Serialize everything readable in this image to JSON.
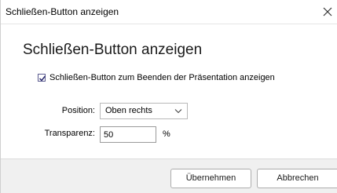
{
  "window": {
    "title": "Schließen-Button anzeigen",
    "close_icon": "close-icon"
  },
  "dialog": {
    "heading": "Schließen-Button anzeigen",
    "checkbox": {
      "label": "Schließen-Button zum Beenden der Präsentation anzeigen",
      "checked": true
    },
    "position": {
      "label": "Position:",
      "value": "Oben rechts"
    },
    "transparency": {
      "label": "Transparenz:",
      "value": "50",
      "unit": "%"
    }
  },
  "footer": {
    "apply_label": "Übernehmen",
    "cancel_label": "Abbrechen"
  },
  "colors": {
    "footer_bg": "#f0f0f0",
    "checkbox_border": "#5b5b8f"
  }
}
